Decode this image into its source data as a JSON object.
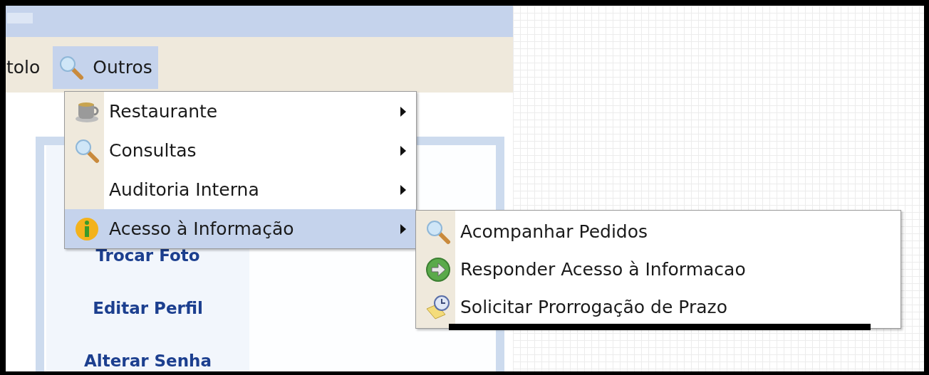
{
  "menubar": [
    {
      "label": "tolo",
      "selected": false,
      "kind": "none"
    },
    {
      "label": "Outros",
      "selected": true,
      "kind": "search"
    }
  ],
  "dropdown": [
    {
      "label": "Restaurante",
      "kind": "cup",
      "has_submenu": true,
      "selected": false
    },
    {
      "label": "Consultas",
      "kind": "search",
      "has_submenu": true,
      "selected": false
    },
    {
      "label": "Auditoria Interna",
      "kind": "none",
      "has_submenu": true,
      "selected": false
    },
    {
      "label": "Acesso à Informação",
      "kind": "info",
      "has_submenu": true,
      "selected": true
    }
  ],
  "submenu": [
    {
      "label": "Acompanhar Pedidos",
      "kind": "search"
    },
    {
      "label": "Responder Acesso à Informacao",
      "kind": "arrow"
    },
    {
      "label": "Solicitar Prorrogação de Prazo",
      "kind": "clock-note"
    }
  ],
  "sidebar": {
    "links": [
      "Trocar Foto",
      "Editar Perfil",
      "Alterar Senha"
    ]
  }
}
